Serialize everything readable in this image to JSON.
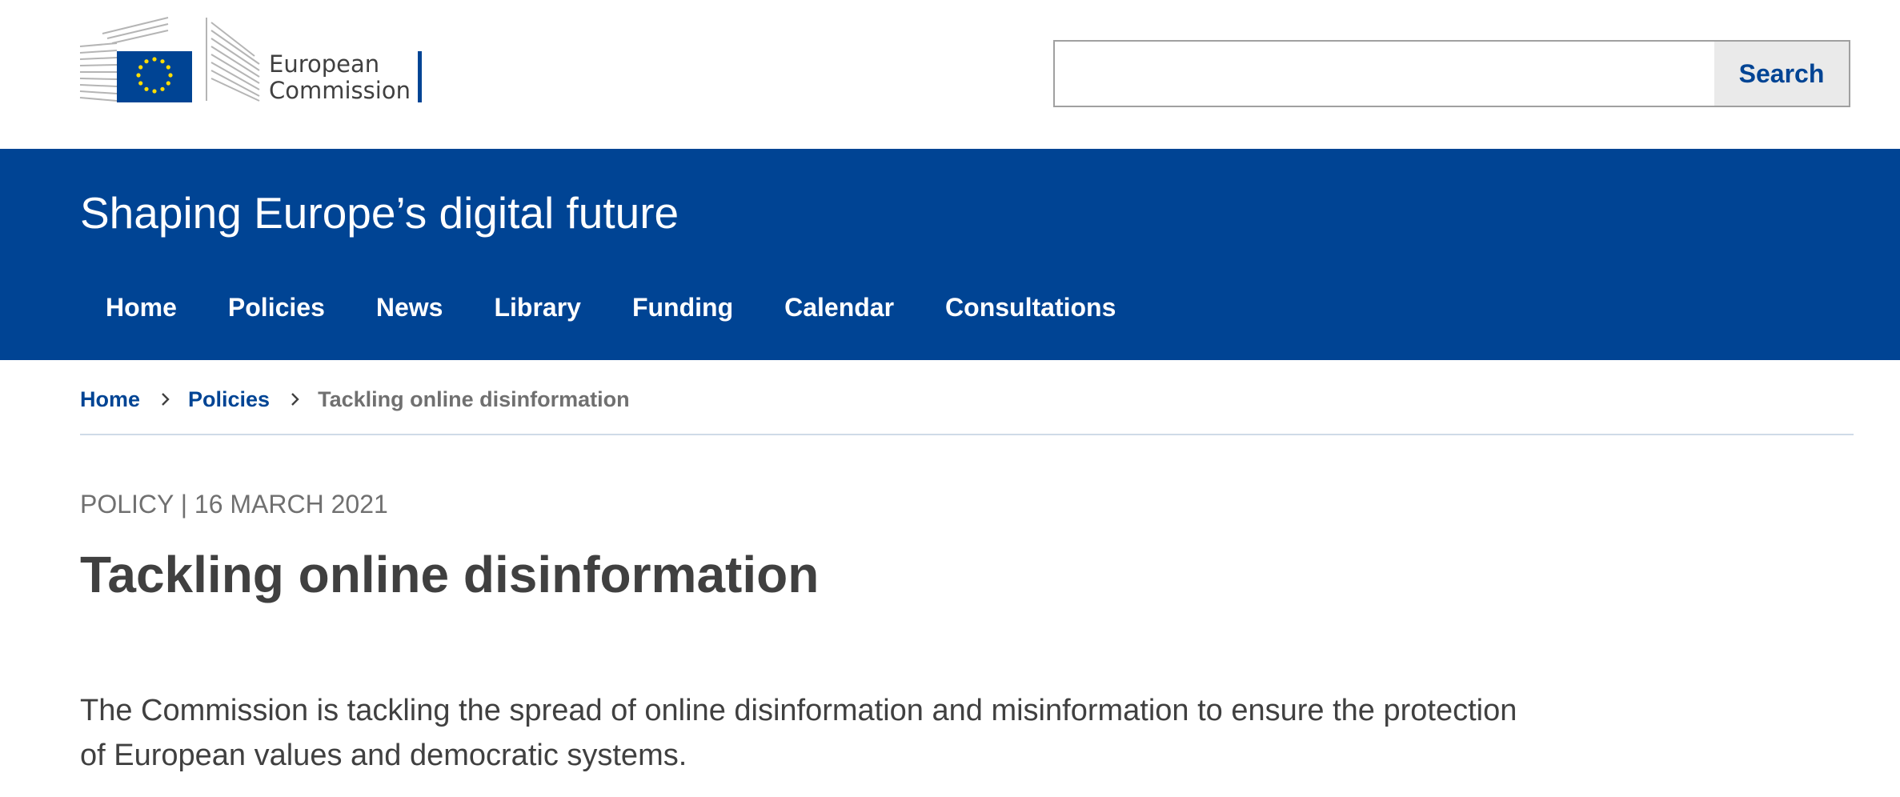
{
  "header": {
    "logo": {
      "line1": "European",
      "line2": "Commission",
      "flag_color": "#004494",
      "star_color": "#FFDD00"
    },
    "search": {
      "placeholder": "",
      "value": "",
      "button_label": "Search"
    }
  },
  "banner": {
    "site_title": "Shaping Europe’s digital future",
    "background_color": "#004494",
    "nav": [
      "Home",
      "Policies",
      "News",
      "Library",
      "Funding",
      "Calendar",
      "Consultations"
    ]
  },
  "breadcrumb": {
    "items": [
      "Home",
      "Policies"
    ],
    "current": "Tackling online disinformation"
  },
  "article": {
    "meta": "POLICY | 16 MARCH 2021",
    "title": "Tackling online disinformation",
    "intro": "The Commission is tackling the spread of online disinformation and misinformation to ensure the protection of European values and democratic systems."
  },
  "icons": {
    "breadcrumb_separator": "chevron-right-icon"
  }
}
